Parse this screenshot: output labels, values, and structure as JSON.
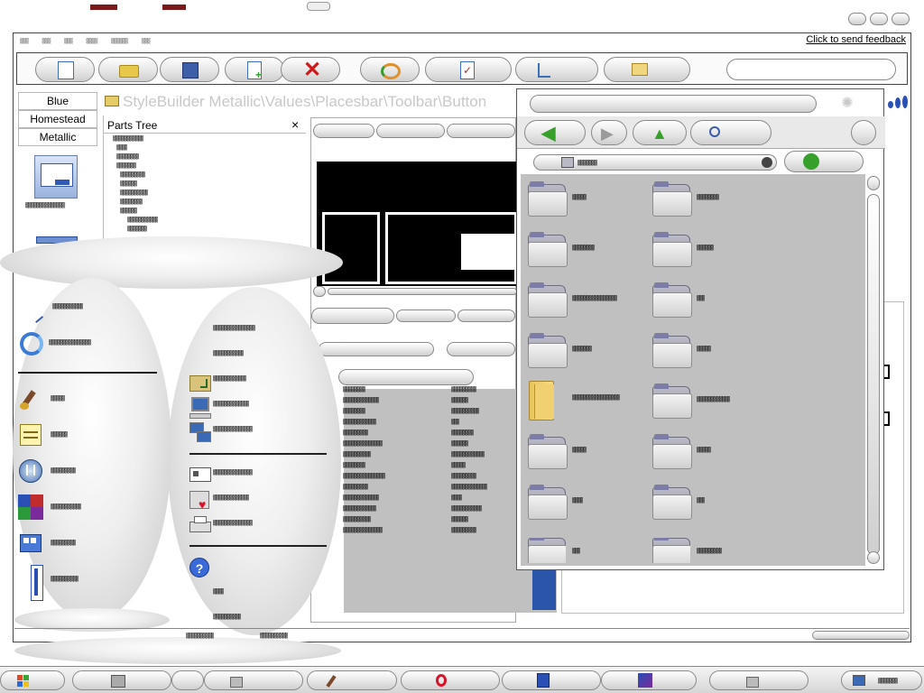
{
  "window": {
    "menu_items": [
      "▒▒▒",
      "▒▒▒",
      "▒▒▒",
      "▒▒▒▒",
      "▒▒▒▒▒▒",
      "▒▒▒"
    ],
    "feedback_link": "Click to send feedback",
    "path_title": "StyleBuilder Metallic\\Values\\Placesbar\\Toolbar\\Button"
  },
  "scheme_tabs": [
    "Blue",
    "Homestead",
    "Metallic"
  ],
  "parts_tree": {
    "title": "Parts Tree",
    "close_glyph": "×",
    "items": [
      "▒▒▒▒▒▒▒▒▒▒▒",
      "▒▒▒▒",
      "▒▒▒▒▒▒▒▒",
      "▒▒▒▒▒▒▒",
      "▒▒▒▒▒▒▒▒▒",
      "▒▒▒▒▒▒",
      "▒▒▒▒▒▒▒▒▒▒",
      "▒▒▒▒▒▒▒▒",
      "▒▒▒▒▒▒",
      "▒▒▒▒▒▒▒▒▒▒▒",
      "▒▒▒▒▒▒▒"
    ]
  },
  "sidebar_preview_label": "▒▒▒▒▒▒▒▒▒▒▒▒▒▒",
  "left_menu": {
    "top_items": [
      "▒▒▒▒▒▒▒▒▒▒▒",
      "▒▒▒▒▒▒▒▒▒▒▒▒▒▒▒"
    ],
    "items": [
      "▒▒▒▒▒",
      "▒▒▒▒▒▒",
      "▒▒▒▒▒▒▒▒▒",
      "▒▒▒▒▒▒▒▒▒▒▒",
      "▒▒▒▒▒▒▒▒▒",
      "▒▒▒▒▒▒▒▒▒▒"
    ]
  },
  "right_menu": {
    "items": [
      "▒▒▒▒▒▒▒▒▒▒▒▒▒▒▒",
      "▒▒▒▒▒▒▒▒▒▒▒",
      "▒▒▒▒▒▒▒▒▒▒▒▒",
      "▒▒▒▒▒▒▒▒▒▒▒▒▒",
      "▒▒▒▒▒▒▒▒▒▒▒▒▒▒",
      "▒▒▒▒▒▒▒▒▒▒▒▒▒▒",
      "▒▒▒▒▒▒▒▒▒▒▒▒▒",
      "▒▒▒▒▒▒▒▒▒▒▒▒▒▒",
      "▒▒▒▒",
      "▒▒▒▒▒▒▒▒▒▒"
    ]
  },
  "properties": {
    "rows": [
      [
        "▒▒▒▒▒▒▒▒",
        "▒▒▒▒▒▒▒▒▒"
      ],
      [
        "▒▒▒▒▒▒▒▒▒▒▒▒▒",
        "▒▒▒▒▒▒"
      ],
      [
        "▒▒▒▒▒▒▒▒",
        "▒▒▒▒▒▒▒▒▒▒"
      ],
      [
        "▒▒▒▒▒▒▒▒▒▒▒▒",
        "▒▒▒"
      ],
      [
        "▒▒▒▒▒▒▒▒▒",
        "▒▒▒▒▒▒▒▒"
      ],
      [
        "▒▒▒▒▒▒▒▒▒▒▒▒▒▒",
        "▒▒▒▒▒▒"
      ],
      [
        "▒▒▒▒▒▒▒▒▒▒",
        "▒▒▒▒▒▒▒▒▒▒▒▒"
      ],
      [
        "▒▒▒▒▒▒▒▒",
        "▒▒▒▒▒"
      ],
      [
        "▒▒▒▒▒▒▒▒▒▒▒▒▒▒▒",
        "▒▒▒▒▒▒▒▒▒"
      ],
      [
        "▒▒▒▒▒▒▒▒▒",
        "▒▒▒▒▒▒▒▒▒▒▒▒▒"
      ],
      [
        "▒▒▒▒▒▒▒▒▒▒▒▒▒",
        "▒▒▒▒"
      ],
      [
        "▒▒▒▒▒▒▒▒▒▒▒▒",
        "▒▒▒▒▒▒▒▒▒▒▒"
      ],
      [
        "▒▒▒▒▒▒▒▒▒▒",
        "▒▒▒▒▒▒"
      ],
      [
        "▒▒▒▒▒▒▒▒▒▒▒▒▒▒",
        "▒▒▒▒▒▒▒▒▒"
      ]
    ]
  },
  "explorer": {
    "address_value": "▒▒▒▒▒▒▒",
    "folders": [
      "▒▒▒▒▒",
      "▒▒▒▒▒▒▒▒",
      "▒▒▒▒▒▒▒▒",
      "▒▒▒▒▒▒",
      "▒▒▒▒▒▒▒▒▒▒▒▒▒▒▒▒",
      "▒▒▒",
      "▒▒▒▒▒▒▒",
      "▒▒▒▒▒",
      "▒▒▒▒▒▒▒▒▒▒▒▒▒▒▒▒▒",
      "▒▒▒▒▒▒▒▒▒▒▒▒",
      "▒▒▒▒▒",
      "▒▒▒▒▒",
      "▒▒▒▒",
      "▒▒▒",
      "▒▒▒",
      "▒▒▒▒▒▒▒▒▒"
    ]
  },
  "statusbar": {
    "left": "▒▒▒▒▒▒▒▒▒▒",
    "right": "▒▒▒▒▒▒▒▒▒▒"
  },
  "taskbar": {
    "clock": "▒▒▒▒▒▒▒"
  },
  "colors": {
    "folder_blue": "#7c7ca6",
    "arrow_green": "#36a02a",
    "opera_red": "#d8142b",
    "preview_black": "#000000",
    "pane_gray": "#c0c0c0"
  }
}
